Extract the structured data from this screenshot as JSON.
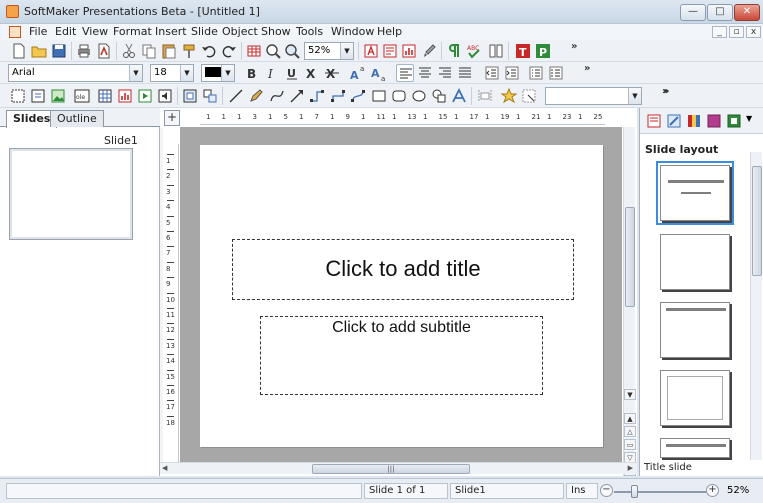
{
  "window": {
    "title": "SoftMaker Presentations Beta - [Untitled 1]",
    "controls": {
      "minimize": "—",
      "maximize": "□",
      "close": "✕"
    }
  },
  "menu": {
    "items": [
      "File",
      "Edit",
      "View",
      "Format",
      "Insert",
      "Slide",
      "Object",
      "Show",
      "Tools",
      "Window",
      "Help"
    ],
    "mdi_controls": {
      "minimize": "_",
      "restore": "▫",
      "close": "x"
    }
  },
  "toolbar1": {
    "zoom_value": "52%",
    "overflow": "»"
  },
  "toolbar2": {
    "font_name": "Arial",
    "font_size": "18",
    "overflow": "»"
  },
  "toolbar3": {
    "style_value": "",
    "overflow": "»"
  },
  "left_panel": {
    "tabs": [
      "Slides",
      "Outline"
    ],
    "active_tab": "Slides",
    "slides": [
      {
        "label": "Slide1"
      }
    ]
  },
  "rulers": {
    "horizontal": [
      "1",
      "1",
      "1",
      "3",
      "1",
      "5",
      "1",
      "7",
      "1",
      "9",
      "1",
      "11",
      "1",
      "13",
      "1",
      "15",
      "1",
      "17",
      "1",
      "19",
      "1",
      "21",
      "1",
      "23",
      "1",
      "25"
    ],
    "vertical": [
      "1",
      "2",
      "3",
      "4",
      "5",
      "6",
      "7",
      "8",
      "9",
      "10",
      "11",
      "12",
      "13",
      "14",
      "15",
      "16",
      "17",
      "18"
    ]
  },
  "slide": {
    "title_placeholder": "Click to add title",
    "subtitle_placeholder": "Click to add subtitle"
  },
  "right_panel": {
    "heading": "Slide layout",
    "layouts": [
      "title",
      "blank",
      "title-only",
      "frame",
      "title-content"
    ],
    "selected_layout": "Title slide",
    "overflow": "»"
  },
  "status_bar": {
    "slide_position": "Slide 1 of 1",
    "slide_name": "Slide1",
    "mode": "Ins",
    "zoom": "52%",
    "zoom_fraction": 0.52
  },
  "colors": {
    "workspace": "#a7a7a7",
    "selection": "#3b8de0",
    "pdf_red": "#c0392b",
    "green_icon": "#2e8b3a",
    "red_icon": "#c62828"
  }
}
